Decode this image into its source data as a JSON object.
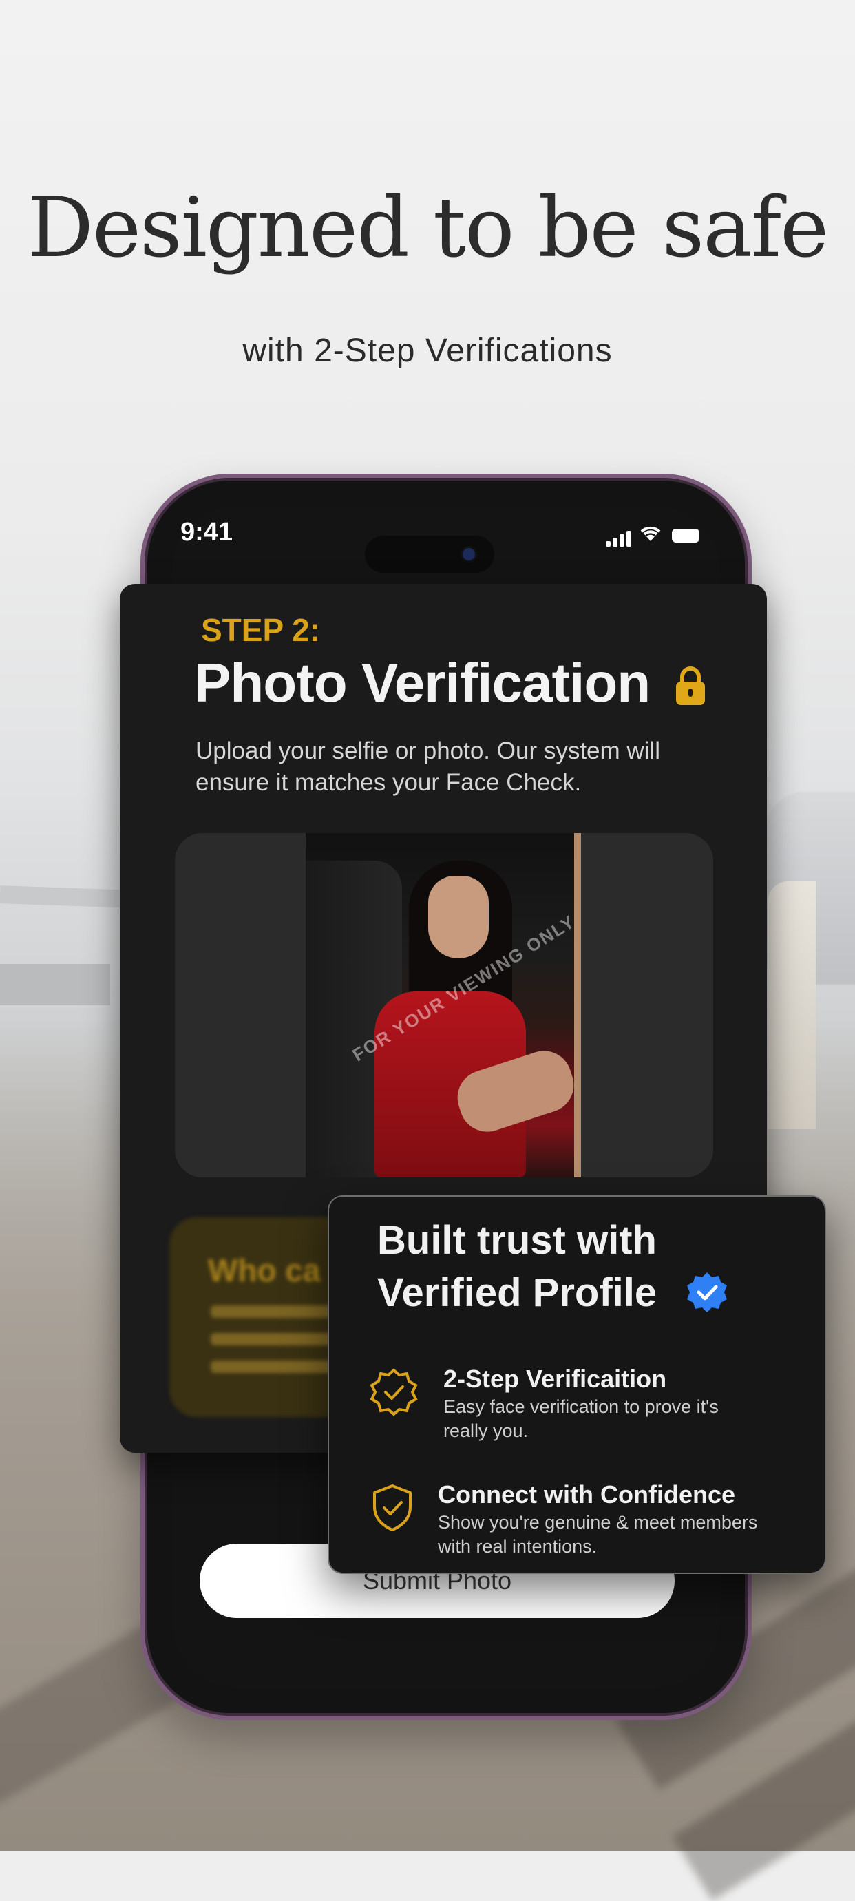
{
  "headline": "Designed to be safe",
  "subheadline": "with 2-Step Verifications",
  "status_bar": {
    "time": "9:41"
  },
  "verification_card": {
    "step_label": "STEP 2:",
    "title": "Photo Verification",
    "description": "Upload your selfie or photo. Our system will ensure it matches your Face Check.",
    "watermark": "FOR YOUR VIEWING ONLY",
    "blurred_section_title": "Who ca"
  },
  "submit_button": {
    "label": "Submit Photo"
  },
  "trust_card": {
    "title_line1": "Built trust with",
    "title_line2": "Verified Profile",
    "features": [
      {
        "title": "2-Step Verificaition",
        "desc_line1": "Easy face verification to prove it's",
        "desc_line2": "really you."
      },
      {
        "title": "Connect with Confidence",
        "desc_line1": "Show you're genuine & meet members",
        "desc_line2": "with real intentions."
      }
    ]
  },
  "colors": {
    "accent_gold": "#d9a21a",
    "verified_blue": "#2f7ff5",
    "phone_frame": "#7c5a7c"
  },
  "icons": [
    "lock-icon",
    "verified-badge-icon",
    "badge-check-icon",
    "shield-check-icon",
    "signal-icon",
    "wifi-icon",
    "battery-icon"
  ]
}
